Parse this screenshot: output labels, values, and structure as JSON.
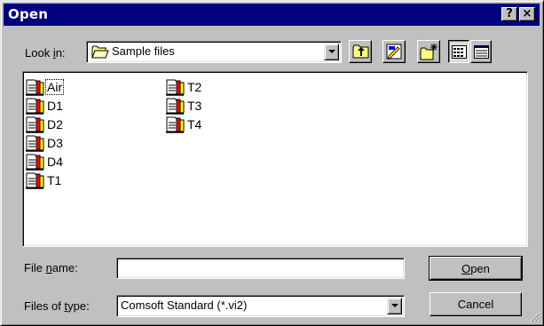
{
  "window": {
    "title": "Open",
    "help_label": "?",
    "close_label": "×"
  },
  "look_in": {
    "label_pre": "Look ",
    "label_hot": "i",
    "label_post": "n:",
    "value": "Sample files",
    "folder_icon": "folder-icon"
  },
  "toolbar": {
    "buttons": [
      {
        "name": "up-one-level",
        "icon": "folder-up-icon"
      },
      {
        "name": "desktop",
        "icon": "desktop-icon"
      },
      {
        "name": "new-folder",
        "icon": "new-folder-icon"
      },
      {
        "name": "list-view",
        "icon": "list-view-icon"
      },
      {
        "name": "details-view",
        "icon": "details-view-icon"
      }
    ]
  },
  "files": {
    "icon": "document-icon",
    "items": [
      "Air",
      "D1",
      "D2",
      "D3",
      "D4",
      "T1",
      "T2",
      "T3",
      "T4"
    ],
    "focused_item": "Air"
  },
  "file_name": {
    "label_pre": "File ",
    "label_hot": "n",
    "label_post": "ame:",
    "value": ""
  },
  "files_of_type": {
    "label_pre": "Files of ",
    "label_hot": "t",
    "label_post": "ype:",
    "value": "Comsoft Standard (*.vi2)"
  },
  "buttons": {
    "open_hot": "O",
    "open_rest": "pen",
    "cancel": "Cancel"
  },
  "colors": {
    "titlebar": "#000080",
    "face": "#c0c0c0",
    "window_bg": "#ffffff"
  }
}
